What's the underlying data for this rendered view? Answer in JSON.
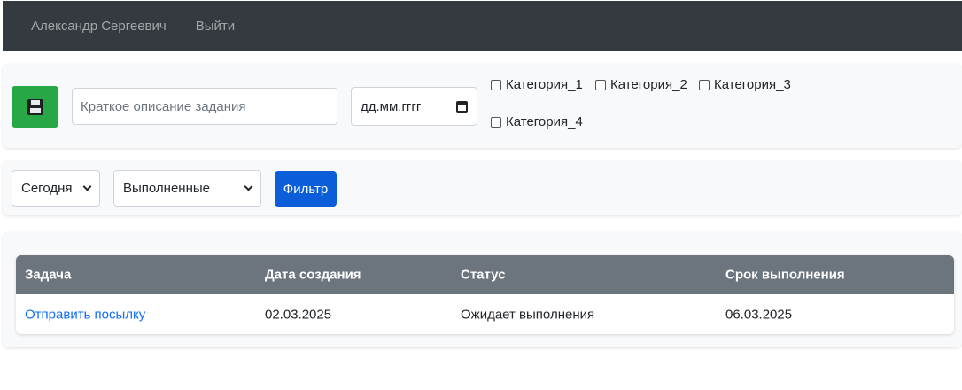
{
  "navbar": {
    "user_name": "Александр Сергеевич",
    "logout_label": "Выйти",
    "background": "#343a40"
  },
  "add_task": {
    "save_icon": "floppy-disk-icon",
    "save_button_color": "#28a745",
    "description_placeholder": "Краткое описание задания",
    "date_placeholder": "дд.мм.гггг",
    "categories": [
      {
        "label": "Категория_1",
        "checked": false
      },
      {
        "label": "Категория_2",
        "checked": false
      },
      {
        "label": "Категория_3",
        "checked": false
      },
      {
        "label": "Категория_4",
        "checked": false
      }
    ]
  },
  "filter": {
    "period_value": "Сегодня",
    "status_value": "Выполненные",
    "button_label": "Фильтр",
    "button_color": "#0b5ed7"
  },
  "table": {
    "headers": [
      "Задача",
      "Дата создания",
      "Статус",
      "Срок выполнения"
    ],
    "header_background": "#6c757d",
    "rows": [
      {
        "task": "Отправить посылку",
        "created": "02.03.2025",
        "status": "Ожидает выполнения",
        "due": "06.03.2025"
      }
    ]
  }
}
